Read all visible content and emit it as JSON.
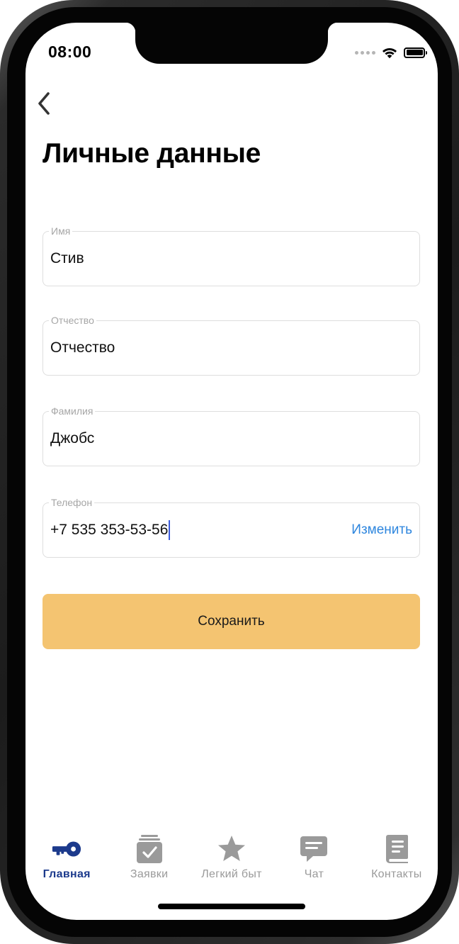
{
  "status_bar": {
    "time": "08:00",
    "icons": [
      "signal-dots-icon",
      "wifi-icon",
      "battery-icon"
    ]
  },
  "nav": {
    "back_icon": "chevron-left-icon"
  },
  "page": {
    "title": "Личные данные"
  },
  "form": {
    "first_name": {
      "label": "Имя",
      "value": "Стив"
    },
    "patronymic": {
      "label": "Отчество",
      "value": "Отчество"
    },
    "last_name": {
      "label": "Фамилия",
      "value": "Джобс"
    },
    "phone": {
      "label": "Телефон",
      "value": "+7 535 353-53-56",
      "action_label": "Изменить"
    }
  },
  "save_button": {
    "label": "Сохранить",
    "color": "#f4c471"
  },
  "tab_bar": {
    "tabs": [
      {
        "label": "Главная",
        "icon": "key-icon",
        "active": true
      },
      {
        "label": "Заявки",
        "icon": "requests-check-icon",
        "active": false
      },
      {
        "label": "Легкий быт",
        "icon": "star-icon",
        "active": false
      },
      {
        "label": "Чат",
        "icon": "chat-bubble-icon",
        "active": false
      },
      {
        "label": "Контакты",
        "icon": "contacts-book-icon",
        "active": false
      }
    ],
    "active_color": "#1c3a8c",
    "inactive_color": "#9a9a9a"
  },
  "colors": {
    "accent_link": "#2e86de",
    "caret": "#3b5bdb"
  }
}
